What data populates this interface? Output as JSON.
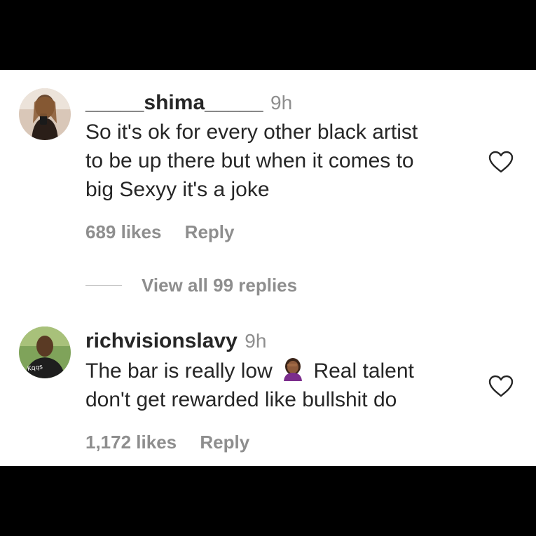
{
  "comments": [
    {
      "username": "_____shima_____",
      "time": "9h",
      "text_lines": [
        "So it's ok for every other black artist",
        "to be up there but when it comes to",
        "big Sexyy it's a joke"
      ],
      "likes": "689 likes",
      "reply_label": "Reply",
      "avatar": "profile-photo"
    },
    {
      "username": "richvisionslavy",
      "time": "9h",
      "text_line1_before": "The bar is really low",
      "emoji": "woman-facepalming-emoji",
      "text_line1_after": "Real talent",
      "text_line2": "don't get rewarded like bullshit do",
      "likes": "1,172 likes",
      "reply_label": "Reply",
      "avatar": "profile-photo"
    }
  ],
  "view_replies": "View all 99 replies",
  "icons": {
    "like": "heart-outline-icon"
  },
  "colors": {
    "text": "#262626",
    "secondary": "#8e8e8e",
    "background": "#ffffff",
    "letterbox": "#000000"
  }
}
